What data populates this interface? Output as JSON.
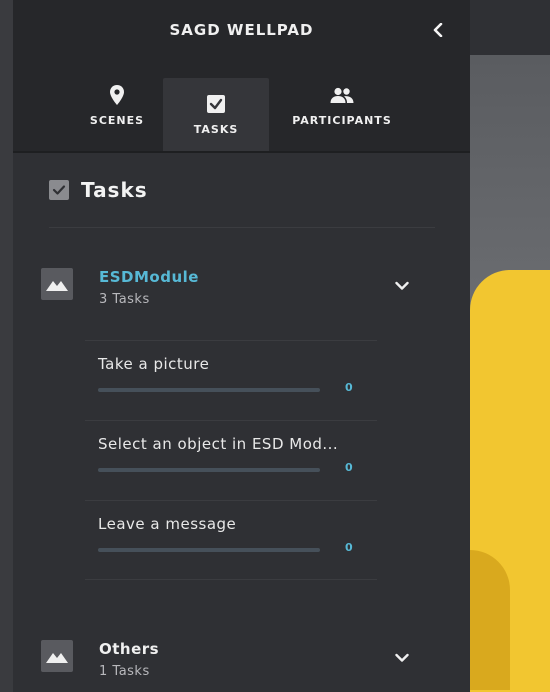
{
  "panel": {
    "title": "SAGD WELLPAD",
    "collapse_icon": "chevron-left-icon"
  },
  "tabs": [
    {
      "label": "SCENES",
      "icon": "map-pin-icon",
      "active": false
    },
    {
      "label": "TASKS",
      "icon": "checkbox-icon",
      "active": true
    },
    {
      "label": "PARTICIPANTS",
      "icon": "people-icon",
      "active": false
    }
  ],
  "section": {
    "title": "Tasks",
    "checked": true
  },
  "modules": [
    {
      "name": "ESDModule",
      "count": "3 Tasks",
      "expanded": true,
      "tasks": [
        {
          "name": "Take a picture",
          "count": "0",
          "progress": 0
        },
        {
          "name": "Select an object in ESD Mod...",
          "count": "0",
          "progress": 0
        },
        {
          "name": "Leave a message",
          "count": "0",
          "progress": 0
        }
      ]
    },
    {
      "name": "Others",
      "count": "1 Tasks",
      "expanded": false
    }
  ],
  "colors": {
    "accent": "#57b9d6",
    "panel_bg": "#2f3034",
    "header_bg": "#26272a",
    "viewport_yellow": "#f2c630"
  }
}
